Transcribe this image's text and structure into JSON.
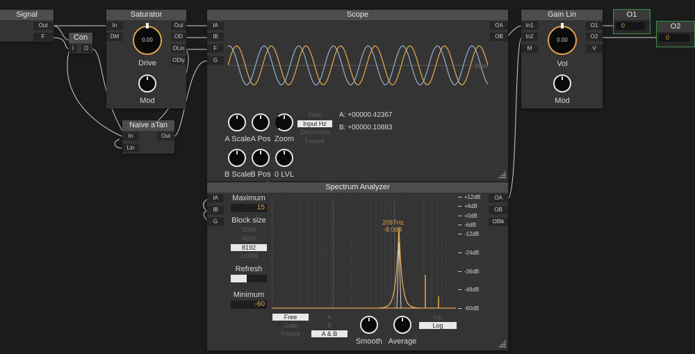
{
  "signal": {
    "title": "Signal",
    "ports": [
      "Out",
      "F"
    ]
  },
  "con": {
    "title": "Con",
    "ports": [
      "I",
      "O"
    ]
  },
  "saturator": {
    "title": "Saturator",
    "inputs": [
      "In",
      "DM"
    ],
    "outputs": [
      "Out",
      "OD",
      "OLin",
      "ODly"
    ],
    "knob_value": "0.00",
    "knob_label": "Drive",
    "mod_label": "Mod"
  },
  "naive": {
    "title": "Naive aTan",
    "ports": [
      "In",
      "Out",
      "Lin"
    ]
  },
  "scope": {
    "title": "Scope",
    "inputs": [
      "IA",
      "IB",
      "F",
      "G"
    ],
    "outputs": [
      "OA",
      "OB"
    ],
    "zero_label": "Zero",
    "knobs": [
      "A Scale",
      "A Pos",
      "Zoom",
      "B Scale",
      "B Pos",
      "0 LVL"
    ],
    "trigger_options": [
      "Free",
      "Input Hz",
      "Zero cross",
      "Freeze"
    ],
    "trigger_selected": "Input Hz",
    "readout_a": "A: +00000.42367",
    "readout_b": "B: +00000.10883"
  },
  "gain": {
    "title": "Gain Lin",
    "inputs": [
      "In1",
      "In2",
      "M"
    ],
    "outputs": [
      "O1",
      "O2",
      "V"
    ],
    "knob_value": "0.00",
    "knob_label": "Vol",
    "mod_label": "Mod"
  },
  "o1": {
    "title": "O1",
    "value": "0"
  },
  "o2": {
    "title": "O2",
    "value": "0"
  },
  "spectrum": {
    "title": "Spectrum Analyzer",
    "inputs": [
      "IA",
      "IB",
      "G"
    ],
    "outputs": [
      "OA",
      "OB",
      "OBlk"
    ],
    "maximum_label": "Maximum",
    "maximum_value": "15",
    "block_label": "Block size",
    "block_options": [
      "2048",
      "4096",
      "8192",
      "16384"
    ],
    "block_selected": "8192",
    "refresh_label": "Refresh",
    "refresh_level": 0.45,
    "minimum_label": "Minimum",
    "minimum_value": "-60",
    "peak_hz": "2097Hz",
    "peak_db": "-8.0dB",
    "db_labels": [
      "+12dB",
      "+6dB",
      "+0dB",
      "-6dB",
      "-12dB",
      "-24dB",
      "-36dB",
      "-48dB",
      "-60dB"
    ],
    "mode_options": [
      "Free",
      "Gate",
      "Freeze"
    ],
    "mode_selected": "Free",
    "channel_options": [
      "A",
      "B",
      "A & B"
    ],
    "channel_selected": "A & B",
    "scale_options": [
      "Lin",
      "Log"
    ],
    "scale_selected": "Log",
    "smooth_label": "Smooth",
    "average_label": "Average"
  },
  "colors": {
    "accent": "#e0a44c",
    "trace_a": "#e0a44c",
    "trace_b": "#8fa8c8",
    "output_border": "#3c8f4d",
    "value_text": "#e0a44c"
  }
}
